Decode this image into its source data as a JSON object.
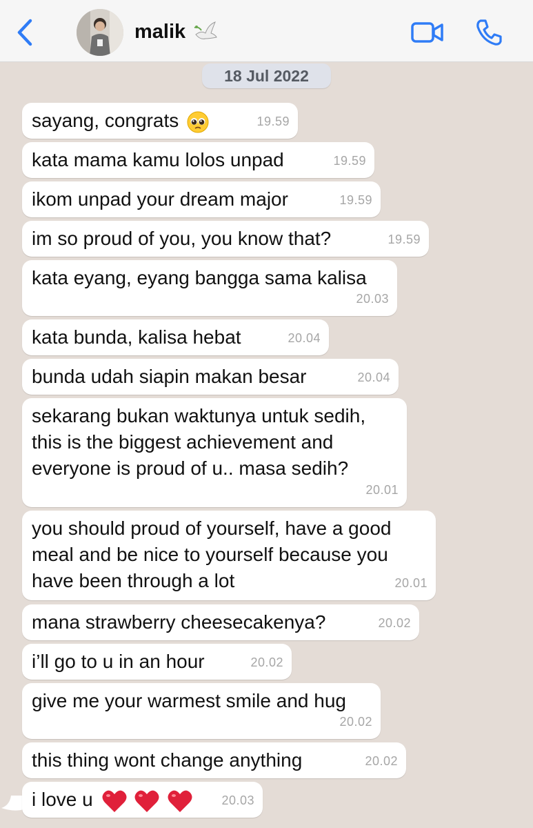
{
  "header": {
    "contact_name": "malik",
    "back_icon": "chevron-left-icon",
    "video_icon": "video-camera-icon",
    "phone_icon": "phone-icon",
    "accent_color": "#2f7cf6"
  },
  "date_chip": "18 Jul 2022",
  "messages": [
    {
      "text": "sayang, congrats",
      "time": "19.59"
    },
    {
      "text": "kata mama kamu lolos unpad",
      "time": "19.59"
    },
    {
      "text": "ikom unpad your dream major",
      "time": "19.59"
    },
    {
      "text": "im so proud of you, you know that?",
      "time": "19.59"
    },
    {
      "text": "kata eyang, eyang bangga sama kalisa",
      "time": "20.03"
    },
    {
      "text": "kata bunda, kalisa hebat",
      "time": "20.04"
    },
    {
      "text": "bunda udah siapin makan besar",
      "time": "20.04"
    },
    {
      "text": "sekarang bukan waktunya untuk sedih,\nthis is the biggest achievement and\neveryone is proud of u.. masa sedih?",
      "time": "20.01"
    },
    {
      "text": "you should proud of yourself, have a good\nmeal and be nice to yourself because you\nhave been through a lot",
      "time": "20.01"
    },
    {
      "text": "mana strawberry cheesecakenya?",
      "time": "20.02"
    },
    {
      "text": "i’ll go to u in an hour",
      "time": "20.02"
    },
    {
      "text": "give me your warmest smile and hug",
      "time": "20.02"
    },
    {
      "text": "this thing wont change anything",
      "time": "20.02"
    },
    {
      "text": "i love u",
      "time": "20.03"
    }
  ]
}
